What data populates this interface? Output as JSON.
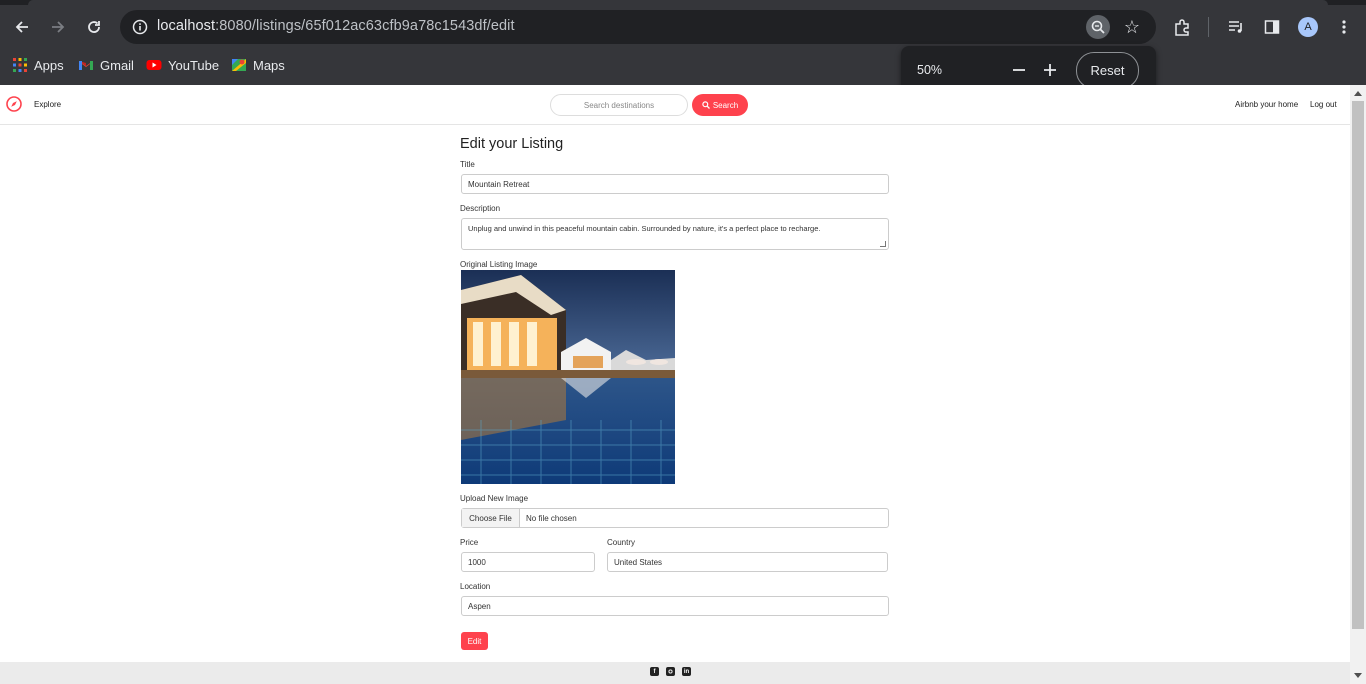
{
  "browser": {
    "url_host": "localhost",
    "url_path": ":8080/listings/65f012ac63cfb9a78c1543df/edit",
    "profile_initial": "A",
    "bookmarks": [
      {
        "label": "Apps",
        "icon": "apps-grid-icon"
      },
      {
        "label": "Gmail",
        "icon": "gmail-icon"
      },
      {
        "label": "YouTube",
        "icon": "youtube-icon"
      },
      {
        "label": "Maps",
        "icon": "maps-icon"
      }
    ],
    "zoom": {
      "percent": "50%",
      "reset_label": "Reset"
    }
  },
  "nav": {
    "explore": "Explore",
    "search_placeholder": "Search destinations",
    "search_button": "Search",
    "airbnb_home": "Airbnb your home",
    "logout": "Log out",
    "accent": "#fe424d"
  },
  "form": {
    "heading": "Edit your Listing",
    "title_label": "Title",
    "title_value": "Mountain Retreat",
    "description_label": "Description",
    "description_value": "Unplug and unwind in this peaceful mountain cabin. Surrounded by nature, it's a perfect place to recharge.",
    "original_image_label": "Original Listing Image",
    "upload_label": "Upload New Image",
    "choose_file": "Choose File",
    "no_file": "No file chosen",
    "price_label": "Price",
    "price_value": "1000",
    "country_label": "Country",
    "country_value": "United States",
    "location_label": "Location",
    "location_value": "Aspen",
    "submit_label": "Edit"
  },
  "footer": {
    "social": [
      "facebook-icon",
      "instagram-icon",
      "linkedin-icon"
    ]
  }
}
